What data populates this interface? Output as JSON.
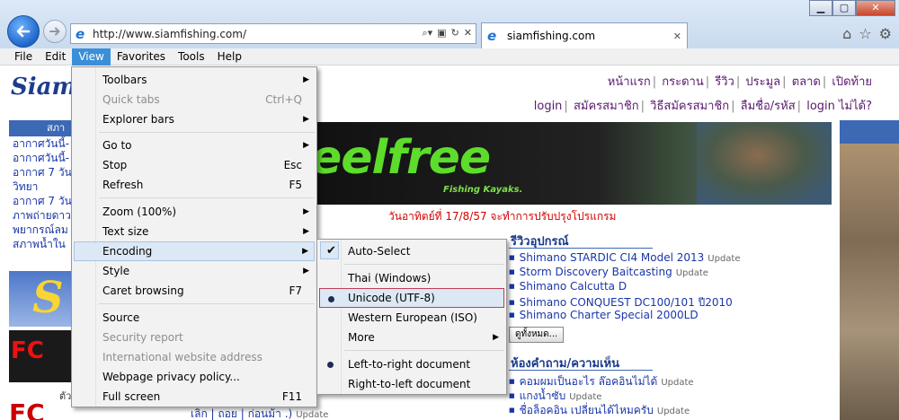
{
  "browser": {
    "url": "http://www.siamfishing.com/",
    "tab_title": "siamfishing.com",
    "tab_close": "✕",
    "icons": [
      "back-arrow-icon",
      "forward-arrow-icon",
      "ie-logo-icon",
      "search-icon",
      "compatibility-icon",
      "refresh-icon",
      "stop-icon",
      "home-icon",
      "favorites-star-icon",
      "settings-gear-icon"
    ]
  },
  "menubar": [
    "File",
    "Edit",
    "View",
    "Favorites",
    "Tools",
    "Help"
  ],
  "view_menu": [
    {
      "label": "Toolbars",
      "shortcut": "",
      "submenu": true,
      "disabled": false
    },
    {
      "label": "Quick tabs",
      "shortcut": "Ctrl+Q",
      "submenu": false,
      "disabled": true
    },
    {
      "label": "Explorer bars",
      "shortcut": "",
      "submenu": true,
      "disabled": false
    },
    {
      "label": "Go to",
      "shortcut": "",
      "submenu": true,
      "disabled": false
    },
    {
      "label": "Stop",
      "shortcut": "Esc",
      "submenu": false,
      "disabled": false
    },
    {
      "label": "Refresh",
      "shortcut": "F5",
      "submenu": false,
      "disabled": false
    },
    {
      "label": "Zoom (100%)",
      "shortcut": "",
      "submenu": true,
      "disabled": false
    },
    {
      "label": "Text size",
      "shortcut": "",
      "submenu": true,
      "disabled": false
    },
    {
      "label": "Encoding",
      "shortcut": "",
      "submenu": true,
      "disabled": false
    },
    {
      "label": "Style",
      "shortcut": "",
      "submenu": true,
      "disabled": false
    },
    {
      "label": "Caret browsing",
      "shortcut": "F7",
      "submenu": false,
      "disabled": false
    },
    {
      "label": "Source",
      "shortcut": "",
      "submenu": false,
      "disabled": false
    },
    {
      "label": "Security report",
      "shortcut": "",
      "submenu": false,
      "disabled": true
    },
    {
      "label": "International website address",
      "shortcut": "",
      "submenu": false,
      "disabled": true
    },
    {
      "label": "Webpage privacy policy...",
      "shortcut": "",
      "submenu": false,
      "disabled": false
    },
    {
      "label": "Full screen",
      "shortcut": "F11",
      "submenu": false,
      "disabled": false
    }
  ],
  "encoding_menu": [
    {
      "label": "Auto-Select",
      "mark": "check"
    },
    {
      "label": "Thai (Windows)",
      "mark": ""
    },
    {
      "label": "Unicode (UTF-8)",
      "mark": "bullet"
    },
    {
      "label": "Western European (ISO)",
      "mark": ""
    },
    {
      "label": "More",
      "mark": "",
      "submenu": true
    },
    {
      "label": "Left-to-right document",
      "mark": "bullet"
    },
    {
      "label": "Right-to-left document",
      "mark": ""
    }
  ],
  "page": {
    "logo_text": "Siam",
    "top_links_1": [
      "หน้าแรก",
      "กระดาน",
      "รีวิว",
      "ประมูล",
      "ตลาด",
      "เปิดท้าย"
    ],
    "top_links_2": [
      "login",
      "สมัครสมาชิก",
      "วิธีสมัครสมาชิก",
      "ลืมชื่อ/รหัส",
      "login ไม่ได้?"
    ],
    "left_header": "สภา",
    "left_links": [
      "อากาศวันนี้-",
      "อากาศวันนี้-",
      "อากาศ 7 วัน",
      "วิทยา",
      "อากาศ 7 วัน",
      "ภาพถ่ายดาว",
      "พยากรณ์ลม",
      "สภาพน้ำใน"
    ],
    "left_banner1": "S",
    "left_banner2": "FC",
    "left_banner3": "FC",
    "left_small": "ตัว",
    "banner_word": "eelfree",
    "banner_sub": "Fishing Kayaks.",
    "notice": "วันอาทิตย์ที่ 17/8/57 จะทำการปรับปรุงโปรแกรม",
    "review_title": "รีวิวอุปกรณ์",
    "reviews": [
      {
        "name": "Shimano STARDIC CI4 Model 2013",
        "update": "Update"
      },
      {
        "name": "Storm Discovery Baitcasting",
        "update": "Update"
      },
      {
        "name": "Shimano Calcutta D",
        "update": ""
      },
      {
        "name": "Shimano CONQUEST DC100/101 ปี2010",
        "update": ""
      },
      {
        "name": "Shimano Charter Special 2000LD",
        "update": ""
      }
    ],
    "more_button": "ดูทั้งหมด...",
    "qa_title": "ห้องคำถาม/ความเห็น",
    "qa_items": [
      {
        "name": "คอมผมเป็นอะไร ล๊อคอินไม่ได้",
        "update": "Update"
      },
      {
        "name": "แกงน้ำซับ",
        "update": "Update"
      },
      {
        "name": "ชื่อล็อคอิน เปลี่ยนได้ไหมครับ",
        "update": "Update"
      }
    ],
    "bottom_text": "เลิก | ถอย | ก่อนม้า .)",
    "bottom_update": "Update"
  }
}
